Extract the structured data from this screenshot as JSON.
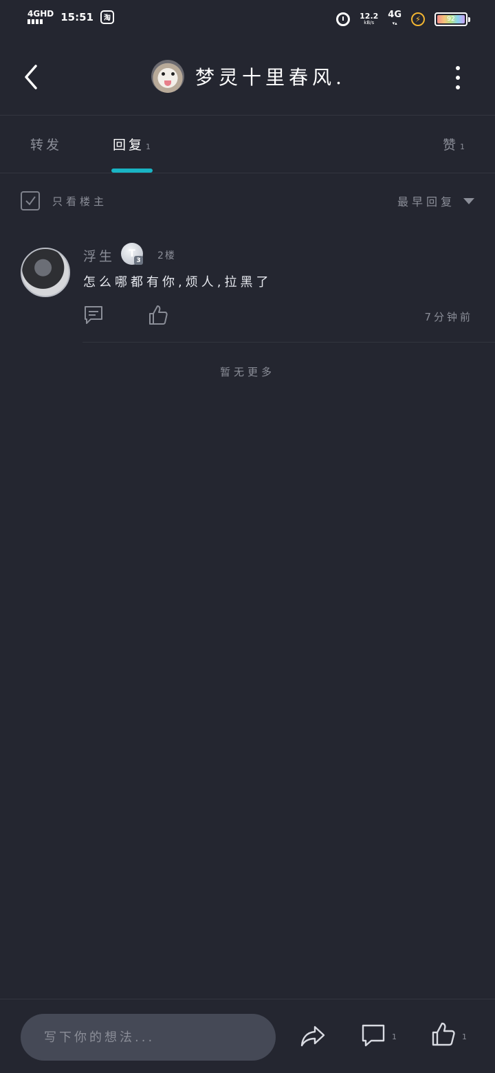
{
  "status_bar": {
    "network_label": "4GHD",
    "time": "15:51",
    "app_badge": "淘",
    "net_speed_value": "12.2",
    "net_speed_unit": "kB/s",
    "network_type": "4G",
    "battery_level": "92"
  },
  "header": {
    "title": "梦灵十里春风."
  },
  "tabs": [
    {
      "label": "转发",
      "count": ""
    },
    {
      "label": "回复",
      "count": "1"
    },
    {
      "label": "赞",
      "count": "1"
    }
  ],
  "filter": {
    "only_op_label": "只看楼主",
    "sort_label": "最早回复"
  },
  "comment": {
    "author": "浮生",
    "badge_letter": "T",
    "badge_level": "3",
    "floor": "2楼",
    "text": "怎么哪都有你,烦人,拉黑了",
    "time": "7分钟前"
  },
  "list_end_text": "暂无更多",
  "bottom_bar": {
    "input_placeholder": "写下你的想法...",
    "comment_count": "1",
    "like_count": "1"
  },
  "colors": {
    "background": "#242630",
    "accent": "#19b4c4",
    "muted_text": "#8b8e98",
    "input_bg": "#454956"
  }
}
